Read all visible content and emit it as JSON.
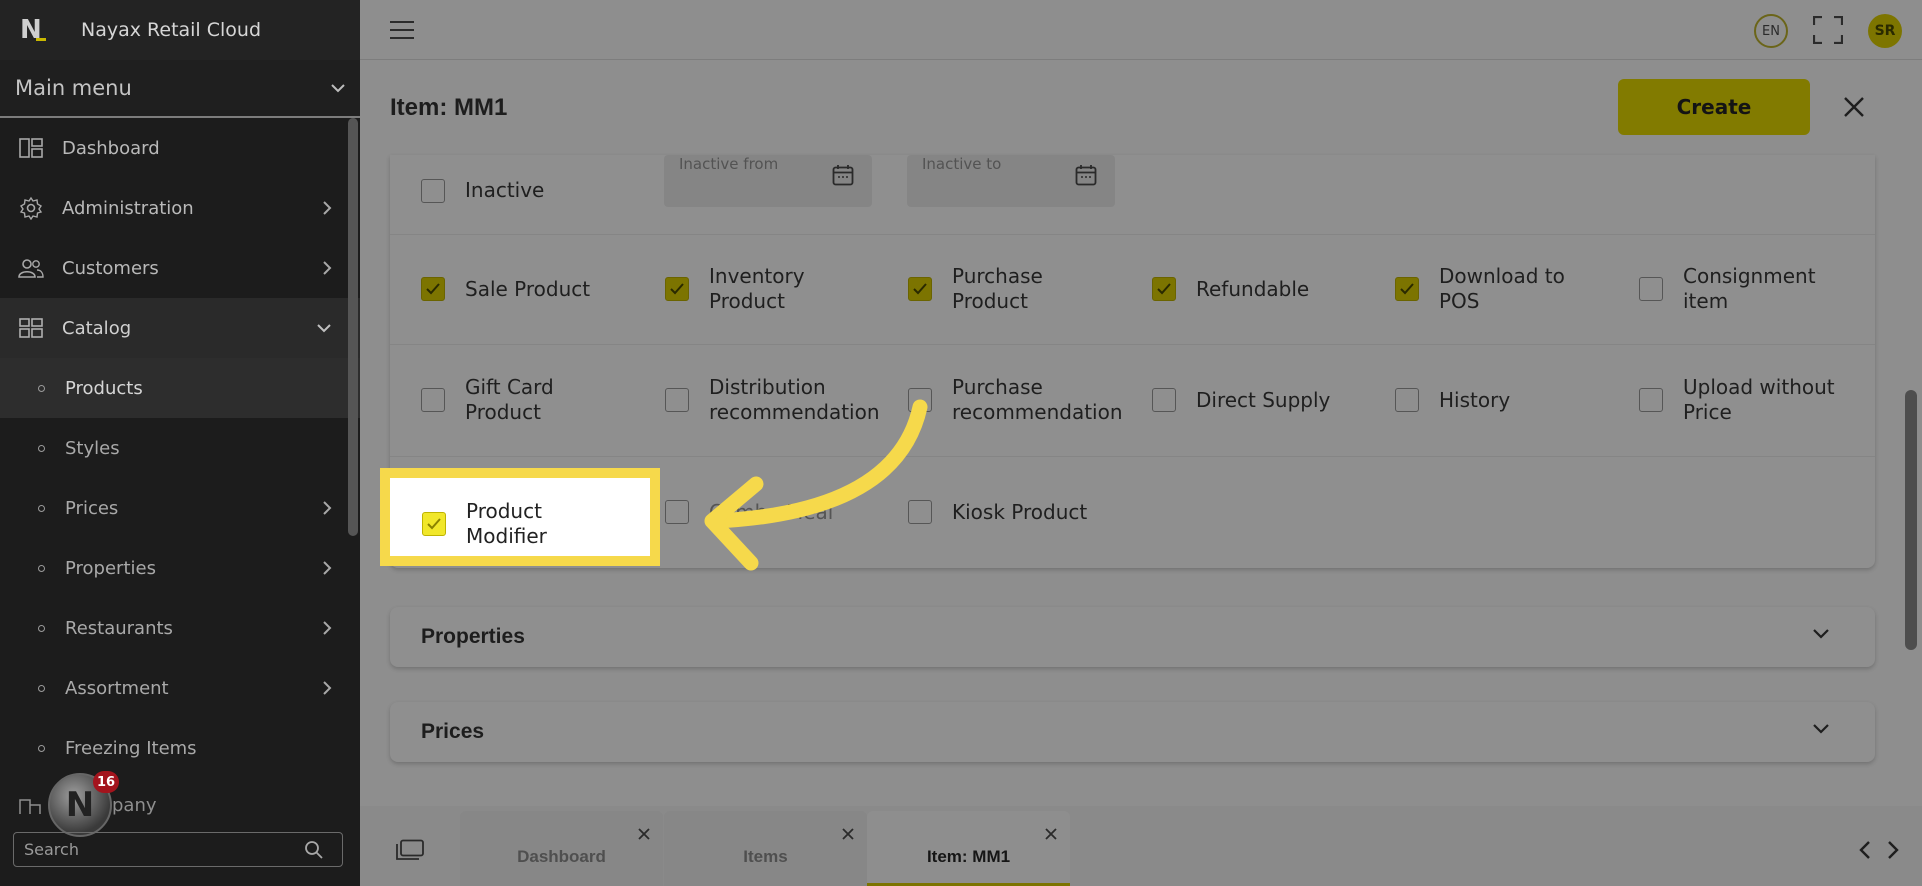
{
  "app": {
    "brand_name": "Nayax Retail Cloud",
    "logo_letter": "N",
    "accent": "#f1e72a",
    "highlight_border": "#f6d94b"
  },
  "sidebar": {
    "main_menu_label": "Main menu",
    "items": [
      {
        "label": "Dashboard",
        "icon": "dashboard-icon"
      },
      {
        "label": "Administration",
        "icon": "gear-icon"
      },
      {
        "label": "Customers",
        "icon": "users-icon"
      },
      {
        "label": "Catalog",
        "icon": "grid-icon"
      }
    ],
    "catalog_children": [
      {
        "label": "Products"
      },
      {
        "label": "Styles"
      },
      {
        "label": "Prices"
      },
      {
        "label": "Properties"
      },
      {
        "label": "Restaurants"
      },
      {
        "label": "Assortment"
      },
      {
        "label": "Freezing Items"
      }
    ],
    "peek_label": "pany",
    "search_placeholder": "Search",
    "notification_count": "16"
  },
  "topbar": {
    "language": "EN",
    "avatar_initials": "SR"
  },
  "header": {
    "title": "Item: MM1",
    "create_label": "Create"
  },
  "status_row": {
    "inactive_label": "Inactive",
    "inactive_from_placeholder": "Inactive from",
    "inactive_to_placeholder": "Inactive to"
  },
  "flags_row1": [
    {
      "label": "Sale Product",
      "checked": true
    },
    {
      "label": "Inventory Product",
      "checked": true
    },
    {
      "label": "Purchase Product",
      "checked": true
    },
    {
      "label": "Refundable",
      "checked": true
    },
    {
      "label": "Download to POS",
      "checked": true
    },
    {
      "label": "Consignment item",
      "checked": false
    }
  ],
  "flags_row2": [
    {
      "label": "Gift Card Product",
      "checked": false
    },
    {
      "label": "Distribution recommendation",
      "checked": false
    },
    {
      "label": "Purchase recommendation",
      "checked": false
    },
    {
      "label": "Direct Supply",
      "checked": false
    },
    {
      "label": "History",
      "checked": false
    },
    {
      "label": "Upload without Price",
      "checked": false
    }
  ],
  "flags_row3": [
    {
      "label": "Product Modifier",
      "checked": true
    },
    {
      "label": "Combo Meal",
      "checked": false
    },
    {
      "label": "Kiosk Product",
      "checked": false
    }
  ],
  "sections": {
    "properties": "Properties",
    "prices": "Prices"
  },
  "tabs": [
    {
      "label": "Dashboard"
    },
    {
      "label": "Items"
    },
    {
      "label": "Item: MM1"
    }
  ]
}
